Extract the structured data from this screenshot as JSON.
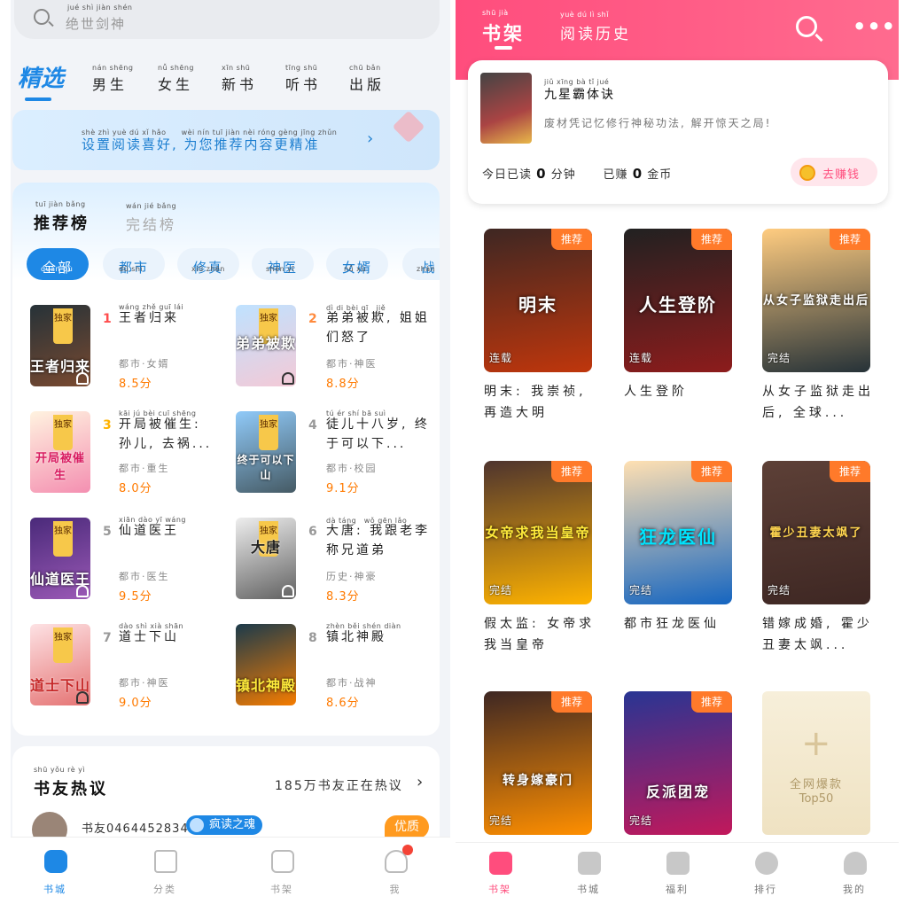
{
  "left": {
    "search_placeholder": "绝世剑神",
    "search_pinyin": "jué shì jiàn shén",
    "tabs": [
      {
        "label": "精选",
        "pinyin": ""
      },
      {
        "label": "男生",
        "pinyin": "nán shēng"
      },
      {
        "label": "女生",
        "pinyin": "nǚ shēng"
      },
      {
        "label": "新书",
        "pinyin": "xīn shū"
      },
      {
        "label": "听书",
        "pinyin": "tīng shū"
      },
      {
        "label": "出版",
        "pinyin": "chū bǎn"
      }
    ],
    "banner": {
      "text": "设置阅读喜好, 为您推荐内容更精准",
      "pinyin": "shè zhì yuè dú xǐ hǎo　　wèi nín tuī jiàn nèi róng gèng jīng zhǔn"
    },
    "rank_tabs": [
      {
        "label": "推荐榜",
        "pinyin": "tuī jiàn bǎng"
      },
      {
        "label": "完结榜",
        "pinyin": "wán jié bǎng"
      }
    ],
    "chips": [
      {
        "label": "全部",
        "pinyin": "quán bù"
      },
      {
        "label": "都市",
        "pinyin": "dū shì"
      },
      {
        "label": "修真",
        "pinyin": "xiū zhēn"
      },
      {
        "label": "神医",
        "pinyin": "shén yī"
      },
      {
        "label": "女婿",
        "pinyin": "nǚ xù"
      },
      {
        "label": "战",
        "pinyin": "zhàn"
      }
    ],
    "books": [
      {
        "rank": "1",
        "title": "王者归来",
        "pinyin": "wáng zhě guī lái",
        "meta": "都市·女婿",
        "score": "8.5分",
        "badge": "独家",
        "cover": "王者归来"
      },
      {
        "rank": "2",
        "title": "弟弟被欺, 姐姐们怒了",
        "pinyin": "dì di bèi qī　jiě",
        "meta": "都市·神医",
        "score": "8.8分",
        "badge": "独家",
        "cover": "弟弟被欺"
      },
      {
        "rank": "3",
        "title": "开局被催生: 孙儿, 去祸...",
        "pinyin": "kāi jú bèi cuī shēng",
        "meta": "都市·重生",
        "score": "8.0分",
        "badge": "独家",
        "cover": "开局被催生"
      },
      {
        "rank": "4",
        "title": "徒儿十八岁, 终于可以下...",
        "pinyin": "tú ér shí bā suì",
        "meta": "都市·校园",
        "score": "9.1分",
        "badge": "独家",
        "cover": "终于可以下山"
      },
      {
        "rank": "5",
        "title": "仙道医王",
        "pinyin": "xiān dào yī wáng",
        "meta": "都市·医生",
        "score": "9.5分",
        "badge": "独家",
        "cover": "仙道医王"
      },
      {
        "rank": "6",
        "title": "大唐: 我跟老李称兄道弟",
        "pinyin": "dà táng　wǒ gēn lǎo",
        "meta": "历史·神豪",
        "score": "8.3分",
        "badge": "独家",
        "cover": "大唐"
      },
      {
        "rank": "7",
        "title": "道士下山",
        "pinyin": "dào shì xià shān",
        "meta": "都市·神医",
        "score": "9.0分",
        "badge": "独家",
        "cover": "道士下山"
      },
      {
        "rank": "8",
        "title": "镇北神殿",
        "pinyin": "zhèn běi shén diàn",
        "meta": "都市·战神",
        "score": "8.6分",
        "badge": "",
        "cover": "镇北神殿"
      }
    ],
    "forum": {
      "title": "书友热议",
      "pinyin": "shū yǒu rè yì",
      "count": "185万书友正在热议",
      "user": "书友0464452834",
      "tag": "疯读之魂",
      "quality": "优质"
    },
    "nav": [
      {
        "label": "书城",
        "pinyin": "shū chéng"
      },
      {
        "label": "分类",
        "pinyin": "fēn lèi"
      },
      {
        "label": "书架",
        "pinyin": "shū jià"
      },
      {
        "label": "我",
        "pinyin": "wǒ"
      }
    ]
  },
  "right": {
    "tab_shelf": "书架",
    "tab_shelf_pinyin": "shū jià",
    "tab_history": "阅读历史",
    "tab_history_pinyin": "yuè dú lì shǐ",
    "more": "•••",
    "current": {
      "title": "九星霸体诀",
      "title_pinyin": "jiǔ xīng bà tǐ jué",
      "desc": "废材凭记忆修行神秘功法, 解开惊天之局!",
      "today_read": "今日已读",
      "minutes": "0",
      "minutes_unit": "分钟",
      "earned": "已赚",
      "coins": "0",
      "coin_unit": "金币",
      "earn_button": "去赚钱"
    },
    "shelf": [
      {
        "title": "明末: 我崇祯, 再造大明",
        "tag": "推荐",
        "status": "连载",
        "cover": "明末"
      },
      {
        "title": "人生登阶",
        "tag": "推荐",
        "status": "连载",
        "cover": "人生登阶"
      },
      {
        "title": "从女子监狱走出后, 全球...",
        "tag": "推荐",
        "status": "完结",
        "cover": "从女子监狱走出后"
      },
      {
        "title": "假太监: 女帝求我当皇帝",
        "tag": "推荐",
        "status": "完结",
        "cover": "女帝求我当皇帝"
      },
      {
        "title": "都市狂龙医仙",
        "tag": "推荐",
        "status": "完结",
        "cover": "狂龙医仙"
      },
      {
        "title": "错嫁成婚, 霍少丑妻太飒...",
        "tag": "推荐",
        "status": "完结",
        "cover": "霍少丑妻太飒了"
      },
      {
        "title": "",
        "tag": "推荐",
        "status": "完结",
        "cover": "转身嫁豪门"
      },
      {
        "title": "",
        "tag": "推荐",
        "status": "完结",
        "cover": "反派团宠"
      }
    ],
    "top50": {
      "line1": "全网爆款",
      "line2": "Top50",
      "plus": "+"
    },
    "nav": [
      {
        "label": "书架",
        "pinyin": "shū jià"
      },
      {
        "label": "书城",
        "pinyin": "shū chéng"
      },
      {
        "label": "福利",
        "pinyin": "fú lì"
      },
      {
        "label": "排行",
        "pinyin": "pái xíng"
      },
      {
        "label": "我的",
        "pinyin": "wǒ de"
      }
    ]
  },
  "colors": {
    "blue": "#1e88e5",
    "pink": "#ff4d7d",
    "orange": "#ff7a00"
  }
}
